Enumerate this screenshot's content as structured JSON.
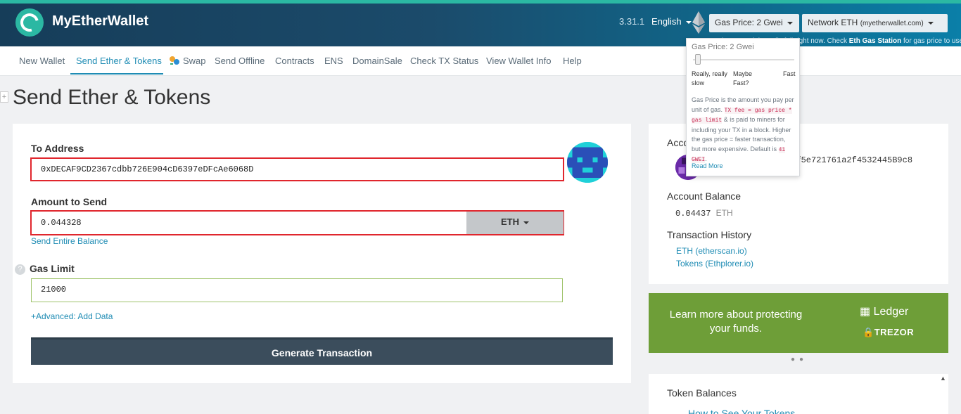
{
  "header": {
    "brand": "MyEtherWallet",
    "version": "3.31.1",
    "language": "English",
    "gas_price_button": "Gas Price: 2 Gwei",
    "network_button": "Network ETH",
    "network_sub": "(myetherwallet.com)",
    "gas_note_pre": "The network is really full right now. Check ",
    "gas_note_link": "Eth Gas Station",
    "gas_note_post": " for gas price to use."
  },
  "nav": {
    "items": [
      "New Wallet",
      "Send Ether & Tokens",
      "Swap",
      "Send Offline",
      "Contracts",
      "ENS",
      "DomainSale",
      "Check TX Status",
      "View Wallet Info",
      "Help"
    ],
    "active": "Send Ether & Tokens"
  },
  "page": {
    "title": "Send Ether & Tokens"
  },
  "form": {
    "to_address_label": "To Address",
    "to_address_value": "0xDECAF9CD2367cdbb726E904cD6397eDFcAe6068D",
    "amount_label": "Amount to Send",
    "amount_value": "0.044328",
    "currency": "ETH",
    "send_entire_balance": "Send Entire Balance",
    "gas_limit_label": "Gas Limit",
    "gas_limit_value": "21000",
    "help_icon": "?",
    "advanced_link": "+Advanced: Add Data",
    "generate_button": "Generate Transaction"
  },
  "sidebar": {
    "account_address_heading": "Account Address",
    "account_address_tail": "a9f5e721761a2f4532445B9c8",
    "account_balance_heading": "Account Balance",
    "balance_value": "0.04437",
    "balance_unit": "ETH",
    "tx_history_heading": "Transaction History",
    "tx_links": [
      "ETH (etherscan.io)",
      "Tokens (Ethplorer.io)"
    ],
    "promo_text": "Learn more about protecting your funds.",
    "promo_ledger": "Ledger",
    "promo_trezor": "TREZOR",
    "token_balances_heading": "Token Balances",
    "token_link": "How to See Your Tokens"
  },
  "gas_popover": {
    "title": "Gas Price: 2 Gwei",
    "slider_level": 0.02,
    "label_slow": "Really, really slow",
    "label_maybe": "Maybe Fast?",
    "label_fast": "Fast",
    "desc_1": "Gas Price is the amount you pay per unit of gas.",
    "desc_code": "TX fee = gas price * gas limit",
    "desc_2": "& is paid to miners for including your TX in a block. Higher the gas price = faster transaction, but more expensive. Default is",
    "desc_default": "41 GWEI",
    "desc_end": ".",
    "read_more": "Read More"
  },
  "colors": {
    "accent": "#1f8cb4",
    "header_dark": "#163d59",
    "highlight_red": "#e0262d",
    "promo_green": "#6e9e38",
    "button_dark": "#3b4d5c"
  }
}
